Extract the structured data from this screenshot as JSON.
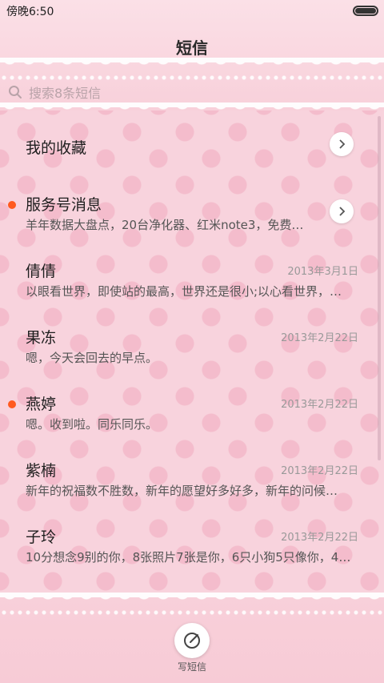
{
  "status": {
    "time": "傍晚6:50"
  },
  "header": {
    "title": "短信"
  },
  "search": {
    "placeholder": "搜索8条短信"
  },
  "favorites": {
    "label": "我的收藏"
  },
  "service": {
    "name": "服务号消息",
    "preview": "羊年数据大盘点，20台净化器、红米note3，免费…"
  },
  "conversations": [
    {
      "name": "倩倩",
      "date": "2013年3月1日",
      "preview": "以眼看世界，即使站的最高，世界还是很小;以心看世界，…",
      "unread": false
    },
    {
      "name": "果冻",
      "date": "2013年2月22日",
      "preview": "嗯，今天会回去的早点。",
      "unread": false
    },
    {
      "name": "燕婷",
      "date": "2013年2月22日",
      "preview": "嗯。收到啦。同乐同乐。",
      "unread": true
    },
    {
      "name": "紫楠",
      "date": "2013年2月22日",
      "preview": "新年的祝福数不胜数，新年的愿望好多好多，新年的问候…",
      "unread": false
    },
    {
      "name": "子玲",
      "date": "2013年2月22日",
      "preview": "10分想念9别的你，8张照片7张是你，6只小狗5只像你，4…",
      "unread": false
    }
  ],
  "compose": {
    "label": "写短信"
  },
  "colors": {
    "unread_dot": "#ff5a1f",
    "background": "#f8d3dd"
  },
  "icons": {
    "search": "search-icon",
    "chevron": "chevron-right-icon",
    "compose": "compose-icon"
  }
}
